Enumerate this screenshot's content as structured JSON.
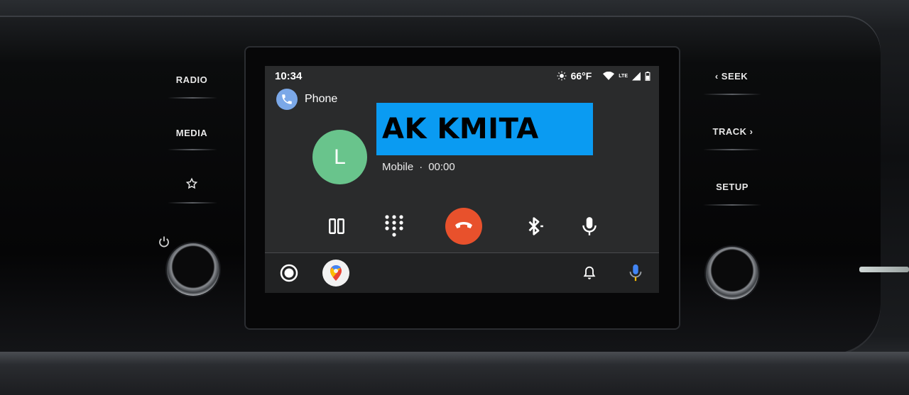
{
  "status": {
    "time": "10:34",
    "temperature": "66°F",
    "network_label": "LTE"
  },
  "app": {
    "name": "Phone",
    "icon": "phone-icon"
  },
  "call": {
    "avatar_letter": "L",
    "caller_name": "AK KMITA",
    "line_type": "Mobile",
    "separator": "·",
    "duration": "00:00",
    "controls": [
      "pause-icon",
      "dialpad-icon",
      "hangup-icon",
      "bluetooth-icon",
      "microphone-icon"
    ],
    "hangup_color": "#e8512c"
  },
  "dock": {
    "items": [
      "home-icon",
      "maps-icon",
      "notifications-icon",
      "assistant-mic-icon"
    ]
  },
  "hardware": {
    "left_buttons": [
      "RADIO",
      "MEDIA"
    ],
    "right_buttons": [
      "‹ SEEK",
      "TRACK ›",
      "SETUP"
    ]
  },
  "colors": {
    "avatar": "#69c48c",
    "banner": "#0a9bf2",
    "screen_bg": "#2a2b2c"
  }
}
